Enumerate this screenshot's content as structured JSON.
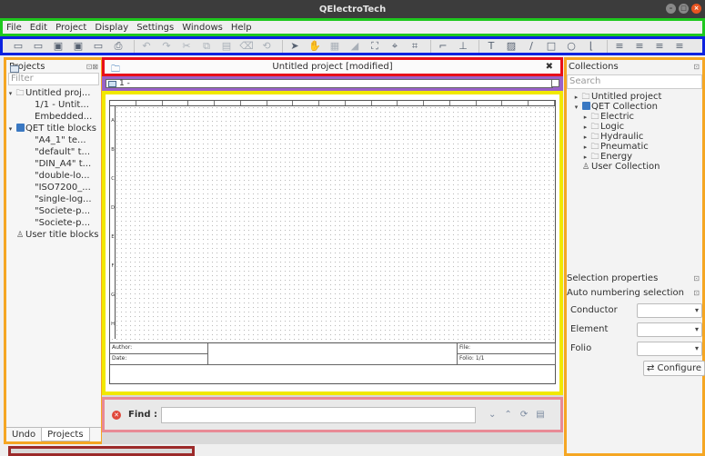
{
  "window": {
    "title": "QElectroTech",
    "controls": [
      "minimize",
      "maximize",
      "close"
    ]
  },
  "menubar": {
    "items": [
      "File",
      "Edit",
      "Project",
      "Display",
      "Settings",
      "Windows",
      "Help"
    ]
  },
  "toolbar": {
    "buttons": [
      {
        "icon": "new-project-icon",
        "glyph": "▭",
        "enabled": true
      },
      {
        "icon": "open-icon",
        "glyph": "▭",
        "enabled": true
      },
      {
        "icon": "save-icon",
        "glyph": "▣",
        "enabled": true
      },
      {
        "icon": "save-as-icon",
        "glyph": "▣",
        "enabled": true
      },
      {
        "icon": "close-project-icon",
        "glyph": "▭",
        "enabled": true
      },
      {
        "icon": "print-icon",
        "glyph": "⎙",
        "enabled": true
      },
      {
        "sep": true
      },
      {
        "icon": "undo-icon",
        "glyph": "↶",
        "enabled": false
      },
      {
        "icon": "redo-icon",
        "glyph": "↷",
        "enabled": false
      },
      {
        "icon": "cut-icon",
        "glyph": "✂",
        "enabled": false
      },
      {
        "icon": "copy-icon",
        "glyph": "⧉",
        "enabled": false
      },
      {
        "icon": "paste-icon",
        "glyph": "▤",
        "enabled": false
      },
      {
        "icon": "delete-icon",
        "glyph": "⌫",
        "enabled": false
      },
      {
        "icon": "rotate-icon",
        "glyph": "⟲",
        "enabled": false
      },
      {
        "sep": true
      },
      {
        "icon": "select-icon",
        "glyph": "➤",
        "enabled": true
      },
      {
        "icon": "pan-hand-icon",
        "glyph": "✋",
        "enabled": true
      },
      {
        "icon": "grid-icon",
        "glyph": "▦",
        "enabled": false
      },
      {
        "icon": "eraser-icon",
        "glyph": "◢",
        "enabled": false
      },
      {
        "icon": "fit-icon",
        "glyph": "⛶",
        "enabled": true
      },
      {
        "icon": "zoom-fit-icon",
        "glyph": "⌖",
        "enabled": true
      },
      {
        "icon": "zoom-reset-icon",
        "glyph": "⌗",
        "enabled": true
      },
      {
        "sep": true
      },
      {
        "icon": "conductor-icon",
        "glyph": "⌐",
        "enabled": true
      },
      {
        "icon": "terminal-strip-icon",
        "glyph": "⊥",
        "enabled": true
      },
      {
        "sep": true
      },
      {
        "icon": "text-icon",
        "glyph": "T",
        "enabled": true
      },
      {
        "icon": "image-icon",
        "glyph": "▨",
        "enabled": true
      },
      {
        "icon": "line-icon",
        "glyph": "∕",
        "enabled": true
      },
      {
        "icon": "rectangle-icon",
        "glyph": "□",
        "enabled": true
      },
      {
        "icon": "ellipse-icon",
        "glyph": "○",
        "enabled": true
      },
      {
        "icon": "polyline-icon",
        "glyph": "⌊",
        "enabled": true
      },
      {
        "sep": true
      },
      {
        "icon": "align-left-icon",
        "glyph": "≡",
        "enabled": true
      },
      {
        "icon": "align-center-icon",
        "glyph": "≡",
        "enabled": true
      },
      {
        "icon": "align-right-icon",
        "glyph": "≡",
        "enabled": true
      },
      {
        "icon": "align-justify-icon",
        "glyph": "≡",
        "enabled": true
      }
    ]
  },
  "projects_panel": {
    "title": "Projects",
    "filter_placeholder": "Filter",
    "tree": [
      {
        "level": 0,
        "arrow": "▾",
        "icon": "folder-icon",
        "glyph": "🗀",
        "label": "Untitled proj..."
      },
      {
        "level": 1,
        "arrow": "",
        "icon": "sheet-icon",
        "glyph": "sheet",
        "label": "1/1 - Untit..."
      },
      {
        "level": 1,
        "arrow": "",
        "icon": "sheet-icon",
        "glyph": "sheet",
        "label": "Embedded..."
      },
      {
        "level": 0,
        "arrow": "▾",
        "icon": "qet-icon",
        "glyph": "qet",
        "label": "QET title blocks"
      },
      {
        "level": 1,
        "arrow": "",
        "icon": "sheet-icon",
        "glyph": "sheet",
        "label": "\"A4_1\" te..."
      },
      {
        "level": 1,
        "arrow": "",
        "icon": "sheet-icon",
        "glyph": "sheet",
        "label": "\"default\" t..."
      },
      {
        "level": 1,
        "arrow": "",
        "icon": "sheet-icon",
        "glyph": "sheet",
        "label": "\"DIN_A4\" t..."
      },
      {
        "level": 1,
        "arrow": "",
        "icon": "sheet-icon",
        "glyph": "sheet",
        "label": "\"double-lo..."
      },
      {
        "level": 1,
        "arrow": "",
        "icon": "sheet-icon",
        "glyph": "sheet",
        "label": "\"ISO7200_..."
      },
      {
        "level": 1,
        "arrow": "",
        "icon": "sheet-icon",
        "glyph": "sheet",
        "label": "\"single-log..."
      },
      {
        "level": 1,
        "arrow": "",
        "icon": "sheet-icon",
        "glyph": "sheet",
        "label": "\"Societe-p..."
      },
      {
        "level": 1,
        "arrow": "",
        "icon": "sheet-icon",
        "glyph": "sheet",
        "label": "\"Societe-p..."
      },
      {
        "level": 0,
        "arrow": "",
        "icon": "user-icon",
        "glyph": "♙",
        "label": "User title blocks"
      }
    ],
    "tabs": [
      "Undo",
      "Projects"
    ],
    "active_tab": "Projects"
  },
  "document": {
    "title": "Untitled project [modified]",
    "folio_tab": "1 -",
    "rows": [
      "A",
      "B",
      "C",
      "D",
      "E",
      "F",
      "G",
      "H"
    ],
    "titleblock": {
      "author_label": "Author:",
      "date_label": "Date:",
      "file_label": "File:",
      "folio_label": "Folio: 1/1"
    }
  },
  "find_bar": {
    "label": "Find :"
  },
  "collections_panel": {
    "title": "Collections",
    "search_placeholder": "Search",
    "tree": [
      {
        "level": 0,
        "arrow": "▸",
        "glyph": "🗀",
        "icon": "folder-icon",
        "label": "Untitled project"
      },
      {
        "level": 0,
        "arrow": "▾",
        "glyph": "qet",
        "icon": "qet-icon",
        "label": "QET Collection"
      },
      {
        "level": 1,
        "arrow": "▸",
        "glyph": "🗀",
        "icon": "folder-icon",
        "label": "Electric"
      },
      {
        "level": 1,
        "arrow": "▸",
        "glyph": "🗀",
        "icon": "folder-icon",
        "label": "Logic"
      },
      {
        "level": 1,
        "arrow": "▸",
        "glyph": "🗀",
        "icon": "folder-icon",
        "label": "Hydraulic"
      },
      {
        "level": 1,
        "arrow": "▸",
        "glyph": "🗀",
        "icon": "folder-icon",
        "label": "Pneumatic"
      },
      {
        "level": 1,
        "arrow": "▸",
        "glyph": "🗀",
        "icon": "folder-icon",
        "label": "Energy"
      },
      {
        "level": 0,
        "arrow": "",
        "glyph": "♙",
        "icon": "user-icon",
        "label": "User Collection"
      }
    ],
    "selection_properties": "Selection properties",
    "auto_numbering": "Auto numbering selection",
    "fields": [
      {
        "label": "Conductor",
        "value": ""
      },
      {
        "label": "Element",
        "value": ""
      },
      {
        "label": "Folio",
        "value": ""
      }
    ],
    "configure_button": "Configure"
  }
}
